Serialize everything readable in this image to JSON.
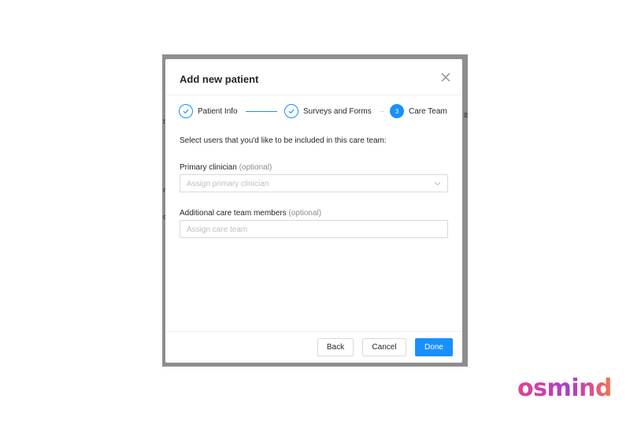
{
  "backdrop": {
    "fragments": [
      "t",
      "lb",
      "r",
      "c"
    ]
  },
  "modal": {
    "title": "Add new patient",
    "steps": [
      {
        "label": "Patient Info",
        "status": "done"
      },
      {
        "label": "Surveys and Forms",
        "status": "done"
      },
      {
        "label": "Care Team",
        "status": "active",
        "number": "3"
      }
    ],
    "intro": "Select users that you'd like to be included in this care team:",
    "primary_clinician": {
      "label": "Primary clinician",
      "optional": "(optional)",
      "placeholder": "Assign primary clinician"
    },
    "additional_members": {
      "label": "Additional care team members",
      "optional": "(optional)",
      "placeholder": "Assign care team"
    },
    "footer": {
      "back": "Back",
      "cancel": "Cancel",
      "done": "Done"
    }
  },
  "brand": {
    "logo_text": "osmind",
    "accent_color": "#1890ff"
  }
}
